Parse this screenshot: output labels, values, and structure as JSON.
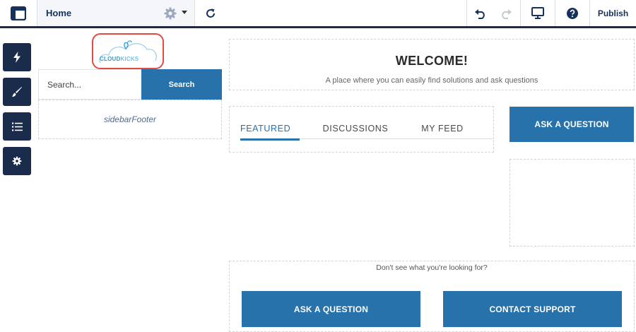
{
  "toolbar": {
    "page_name": "Home",
    "publish_label": "Publish",
    "icons": [
      "layout-icon",
      "gear-icon",
      "chevron-down-icon",
      "refresh-icon",
      "undo-icon",
      "redo-icon",
      "monitor-icon",
      "help-icon"
    ]
  },
  "rail": {
    "items": [
      {
        "icon": "lightning-icon"
      },
      {
        "icon": "brush-icon"
      },
      {
        "icon": "list-icon"
      },
      {
        "icon": "gear-icon"
      }
    ]
  },
  "sidebar": {
    "logo": {
      "part1": "CLOUD",
      "part2": "KICKS"
    },
    "search_placeholder": "Search...",
    "search_button": "Search",
    "footer_text": "sidebarFooter"
  },
  "main": {
    "welcome_title": "WELCOME!",
    "welcome_subtitle": "A place where you can easily find solutions and ask questions",
    "tabs": [
      {
        "label": "FEATURED",
        "active": true
      },
      {
        "label": "DISCUSSIONS",
        "active": false
      },
      {
        "label": "MY FEED",
        "active": false
      }
    ],
    "ask_question_label": "ASK A QUESTION",
    "help_text": "Don't see what you're looking for?",
    "bottom_ask_label": "ASK A QUESTION",
    "contact_support_label": "CONTACT SUPPORT"
  },
  "colors": {
    "navy": "#1b2b4b",
    "primary_blue": "#2872ab",
    "highlight_red": "#e04a3f"
  }
}
